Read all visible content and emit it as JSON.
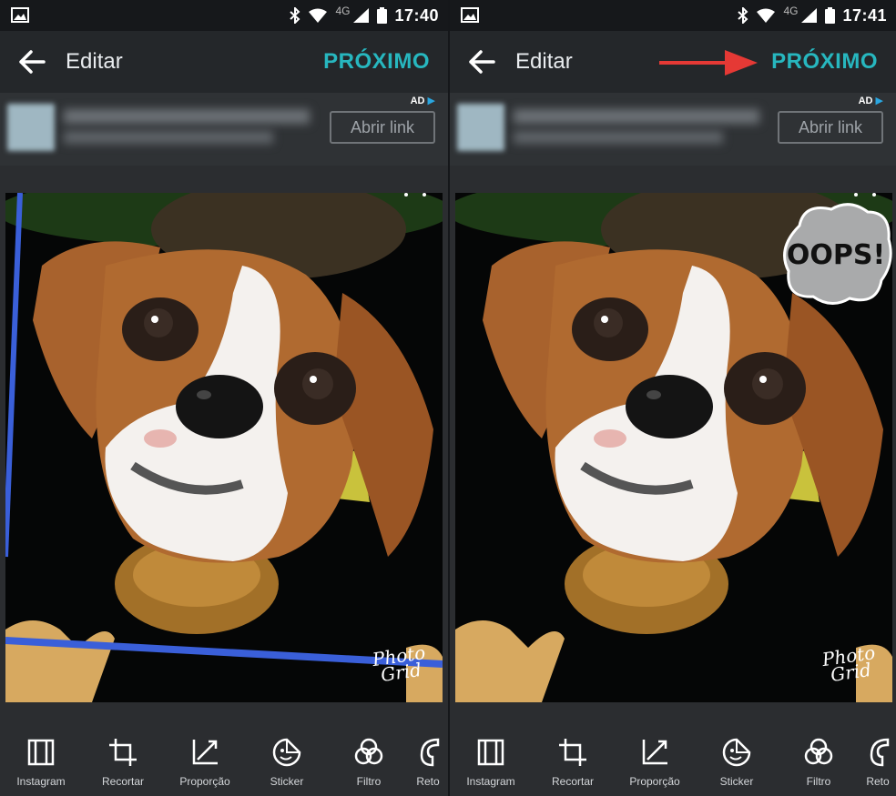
{
  "status": {
    "network": "4G",
    "time_left": "17:40",
    "time_right": "17:41"
  },
  "header": {
    "title": "Editar",
    "next": "PRÓXIMO"
  },
  "ad": {
    "tag": "AD",
    "button": "Abrir link"
  },
  "photo": {
    "watermark_line1": "Photo",
    "watermark_line2": "Grid",
    "sticker_text": "OOPS!"
  },
  "toolbar": {
    "items": [
      {
        "label": "Instagram",
        "icon": "instagram-frame-icon"
      },
      {
        "label": "Recortar",
        "icon": "crop-icon"
      },
      {
        "label": "Proporção",
        "icon": "ratio-icon"
      },
      {
        "label": "Sticker",
        "icon": "sticker-icon"
      },
      {
        "label": "Filtro",
        "icon": "filter-icon"
      },
      {
        "label": "Reto",
        "icon": "retouch-icon"
      }
    ]
  },
  "colors": {
    "accent": "#27b7bf",
    "arrow": "#e53935",
    "overlay_line": "#3a5fd9"
  }
}
